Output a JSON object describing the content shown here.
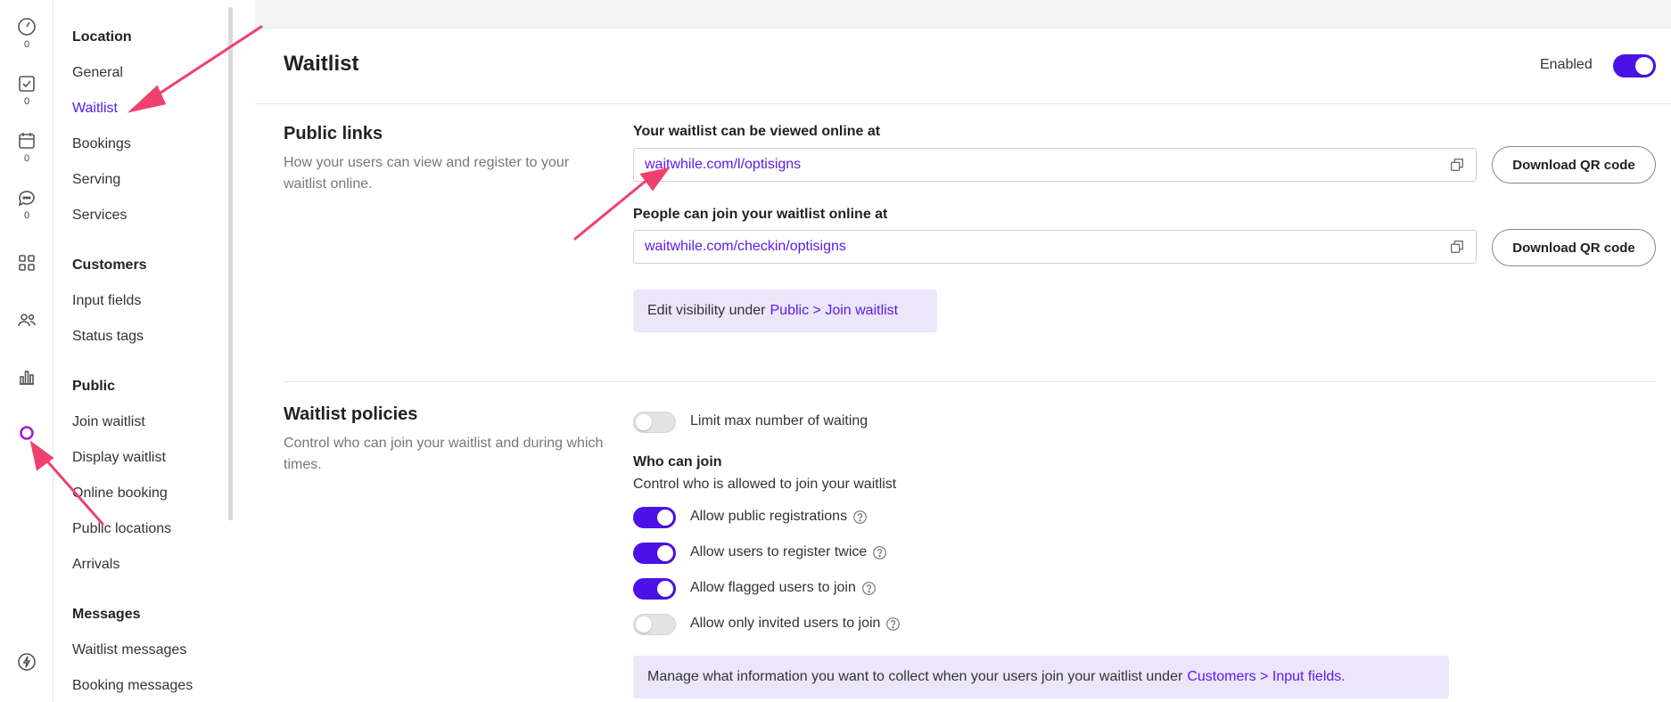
{
  "rail": {
    "counts": [
      "0",
      "0",
      "0",
      "0"
    ]
  },
  "nav": {
    "groups": [
      {
        "heading": "Location",
        "items": [
          "General",
          "Waitlist",
          "Bookings",
          "Serving",
          "Services"
        ]
      },
      {
        "heading": "Customers",
        "items": [
          "Input fields",
          "Status tags"
        ]
      },
      {
        "heading": "Public",
        "items": [
          "Join waitlist",
          "Display waitlist",
          "Online booking",
          "Public locations",
          "Arrivals"
        ]
      },
      {
        "heading": "Messages",
        "items": [
          "Waitlist messages",
          "Booking messages"
        ]
      }
    ],
    "active_item": "Waitlist"
  },
  "header": {
    "title": "Waitlist",
    "enabled_label": "Enabled",
    "enabled": true
  },
  "public_links": {
    "title": "Public links",
    "description": "How your users can view and register to your waitlist online.",
    "view_label": "Your waitlist can be viewed online at",
    "view_url": "waitwhile.com/l/optisigns",
    "join_label": "People can join your waitlist online at",
    "join_url": "waitwhile.com/checkin/optisigns",
    "qr_button": "Download QR code",
    "visibility_text": "Edit visibility under",
    "visibility_link": "Public > Join waitlist"
  },
  "policies": {
    "title": "Waitlist policies",
    "description": "Control who can join your waitlist and during which times.",
    "limit_label": "Limit max number of waiting",
    "limit_enabled": false,
    "who_heading": "Who can join",
    "who_desc": "Control who is allowed to join your waitlist",
    "options": [
      {
        "label": "Allow public registrations",
        "on": true
      },
      {
        "label": "Allow users to register twice",
        "on": true
      },
      {
        "label": "Allow flagged users to join",
        "on": true
      },
      {
        "label": "Allow only invited users to join",
        "on": false
      }
    ],
    "manage_text": "Manage what information you want to collect when your users join your waitlist under",
    "manage_link": "Customers > Input fields."
  },
  "colors": {
    "accent": "#4a12e6",
    "link": "#5a1bf0",
    "annotation_arrow": "#f0406e"
  }
}
